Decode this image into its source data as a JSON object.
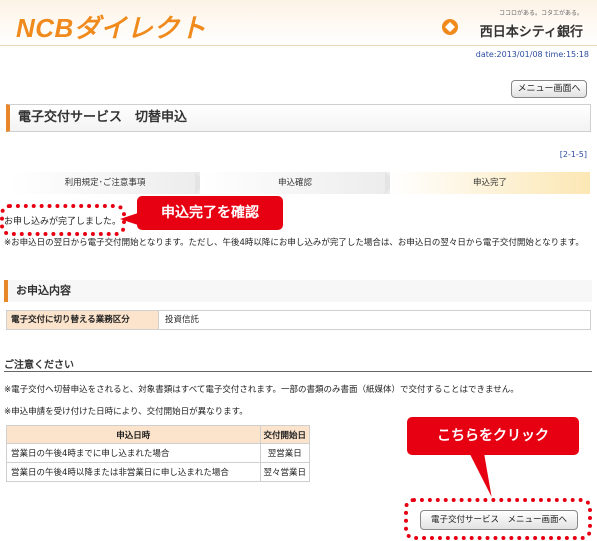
{
  "header": {
    "logo": "NCBダイレクト",
    "bank_tagline": "ココロがある。コタエがある。",
    "bank_name": "西日本シティ銀行",
    "datetime": "date:2013/01/08 time:15:18"
  },
  "menu_button": "メニュー画面へ",
  "page_title": "電子交付サービス　切替申込",
  "step_number": "[2-1-5]",
  "steps": [
    "利用規定･ご注意事項",
    "申込確認",
    "申込完了"
  ],
  "completion_message": "お申し込みが完了しました。",
  "notice": "※お申込日の翌日から電子交付開始となります。ただし、午後4時以降にお申し込みが完了した場合は、お申込日の翌々日から電子交付開始となります。",
  "section_title": "お申込内容",
  "application": {
    "key": "電子交付に切り替える業務区分",
    "value": "投資信託"
  },
  "caution": {
    "heading": "ご注意ください",
    "line1": "※電子交付へ切替申込をされると、対象書類はすべて電子交付されます。一部の書類のみ書面（紙媒体）で交付することはできません。",
    "line2": "※申込申請を受け付けた日時により、交付開始日が異なります。"
  },
  "start_table": {
    "headers": [
      "申込日時",
      "交付開始日"
    ],
    "rows": [
      [
        "営業日の午後4時までに申し込まれた場合",
        "翌営業日"
      ],
      [
        "営業日の午後4時以降または非営業日に申し込まれた場合",
        "翌々営業日"
      ]
    ]
  },
  "bottom_button": "電子交付サービス　メニュー画面へ",
  "callouts": {
    "confirm": "申込完了を確認",
    "click": "こちらをクリック"
  },
  "colors": {
    "brand_orange": "#f08a1c",
    "callout_red": "#e60012",
    "table_header": "#fbe3cc"
  }
}
